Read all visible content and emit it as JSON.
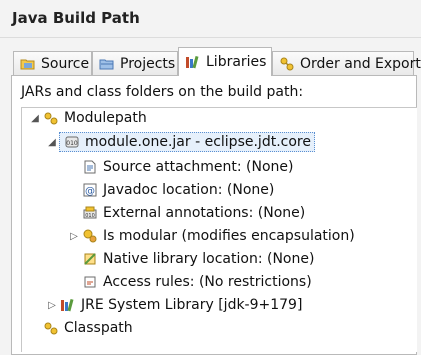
{
  "window": {
    "title": "Java Build Path"
  },
  "tabs": [
    {
      "label": "Source",
      "icon": "source-folder-icon"
    },
    {
      "label": "Projects",
      "icon": "projects-icon"
    },
    {
      "label": "Libraries",
      "icon": "libraries-icon",
      "active": true
    },
    {
      "label": "Order and Export",
      "icon": "order-export-icon"
    }
  ],
  "libraries": {
    "caption": "JARs and class folders on the build path:",
    "tree": {
      "modulepath": "Modulepath",
      "module_jar": "module.one.jar - eclipse.jdt.core",
      "source_attachment": "Source attachment: (None)",
      "javadoc_location": "Javadoc location: (None)",
      "external_annotations": "External annotations: (None)",
      "is_modular": "Is modular (modifies encapsulation)",
      "native_library": "Native library location: (None)",
      "access_rules": "Access rules: (No restrictions)",
      "jre_library": "JRE System Library [jdk-9+179]",
      "classpath": "Classpath"
    }
  },
  "colors": {
    "selection_border": "#5a8fd1",
    "selection_bg": "#e6f0fb"
  }
}
